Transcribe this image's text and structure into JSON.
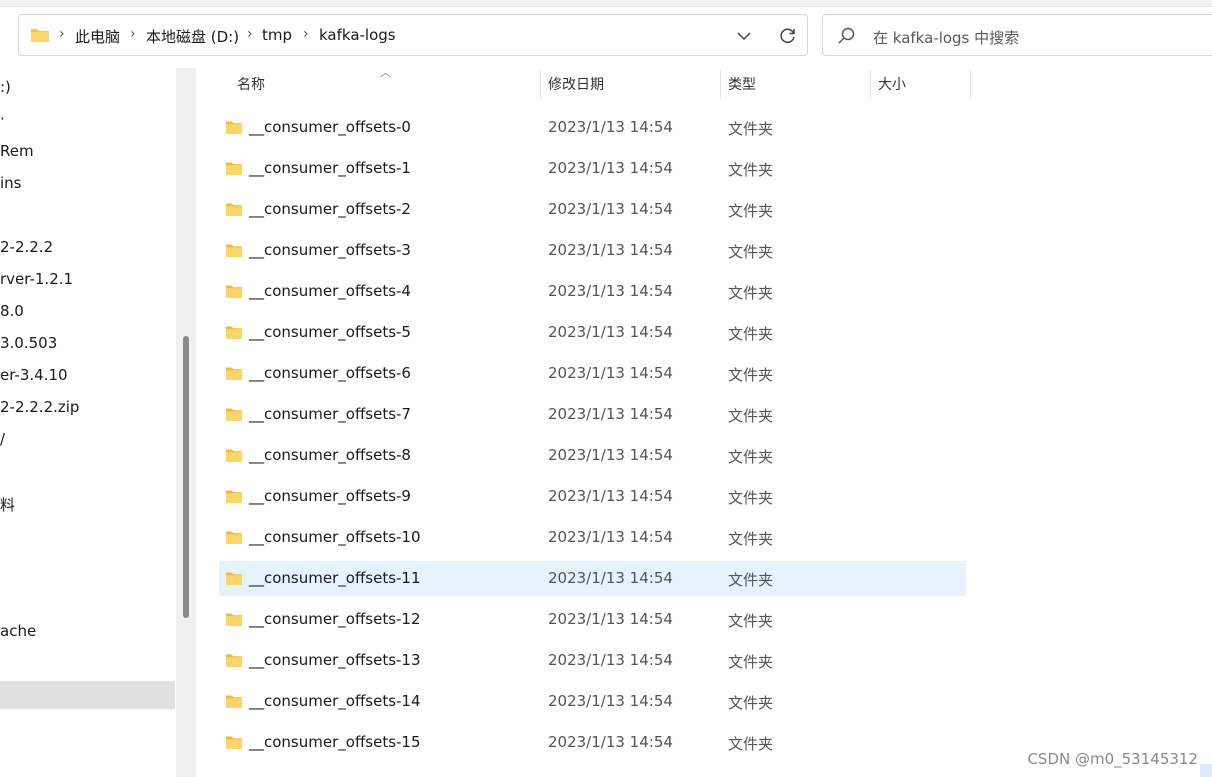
{
  "address": {
    "crumbs": [
      "此电脑",
      "本地磁盘 (D:)",
      "tmp",
      "kafka-logs"
    ]
  },
  "search": {
    "placeholder": "在 kafka-logs 中搜索"
  },
  "nav": {
    "items": [
      ":)",
      "·",
      "Rem",
      "ins",
      "2-2.2.2",
      "rver-1.2.1",
      "8.0",
      "3.0.503",
      "er-3.4.10",
      "2-2.2.2.zip",
      "/",
      "料",
      "ache"
    ]
  },
  "columns": {
    "name": "名称",
    "modified": "修改日期",
    "type": "类型",
    "size": "大小"
  },
  "files": [
    {
      "name": "__consumer_offsets-0",
      "date": "2023/1/13 14:54",
      "type": "文件夹"
    },
    {
      "name": "__consumer_offsets-1",
      "date": "2023/1/13 14:54",
      "type": "文件夹"
    },
    {
      "name": "__consumer_offsets-2",
      "date": "2023/1/13 14:54",
      "type": "文件夹"
    },
    {
      "name": "__consumer_offsets-3",
      "date": "2023/1/13 14:54",
      "type": "文件夹"
    },
    {
      "name": "__consumer_offsets-4",
      "date": "2023/1/13 14:54",
      "type": "文件夹"
    },
    {
      "name": "__consumer_offsets-5",
      "date": "2023/1/13 14:54",
      "type": "文件夹"
    },
    {
      "name": "__consumer_offsets-6",
      "date": "2023/1/13 14:54",
      "type": "文件夹"
    },
    {
      "name": "__consumer_offsets-7",
      "date": "2023/1/13 14:54",
      "type": "文件夹"
    },
    {
      "name": "__consumer_offsets-8",
      "date": "2023/1/13 14:54",
      "type": "文件夹"
    },
    {
      "name": "__consumer_offsets-9",
      "date": "2023/1/13 14:54",
      "type": "文件夹"
    },
    {
      "name": "__consumer_offsets-10",
      "date": "2023/1/13 14:54",
      "type": "文件夹"
    },
    {
      "name": "__consumer_offsets-11",
      "date": "2023/1/13 14:54",
      "type": "文件夹"
    },
    {
      "name": "__consumer_offsets-12",
      "date": "2023/1/13 14:54",
      "type": "文件夹"
    },
    {
      "name": "__consumer_offsets-13",
      "date": "2023/1/13 14:54",
      "type": "文件夹"
    },
    {
      "name": "__consumer_offsets-14",
      "date": "2023/1/13 14:54",
      "type": "文件夹"
    },
    {
      "name": "__consumer_offsets-15",
      "date": "2023/1/13 14:54",
      "type": "文件夹"
    }
  ],
  "hovered_row": "__consumer_offsets-11",
  "watermark": "CSDN @m0_53145312",
  "colors": {
    "folder": "#f8c846",
    "selection": "#e5f3ff"
  }
}
